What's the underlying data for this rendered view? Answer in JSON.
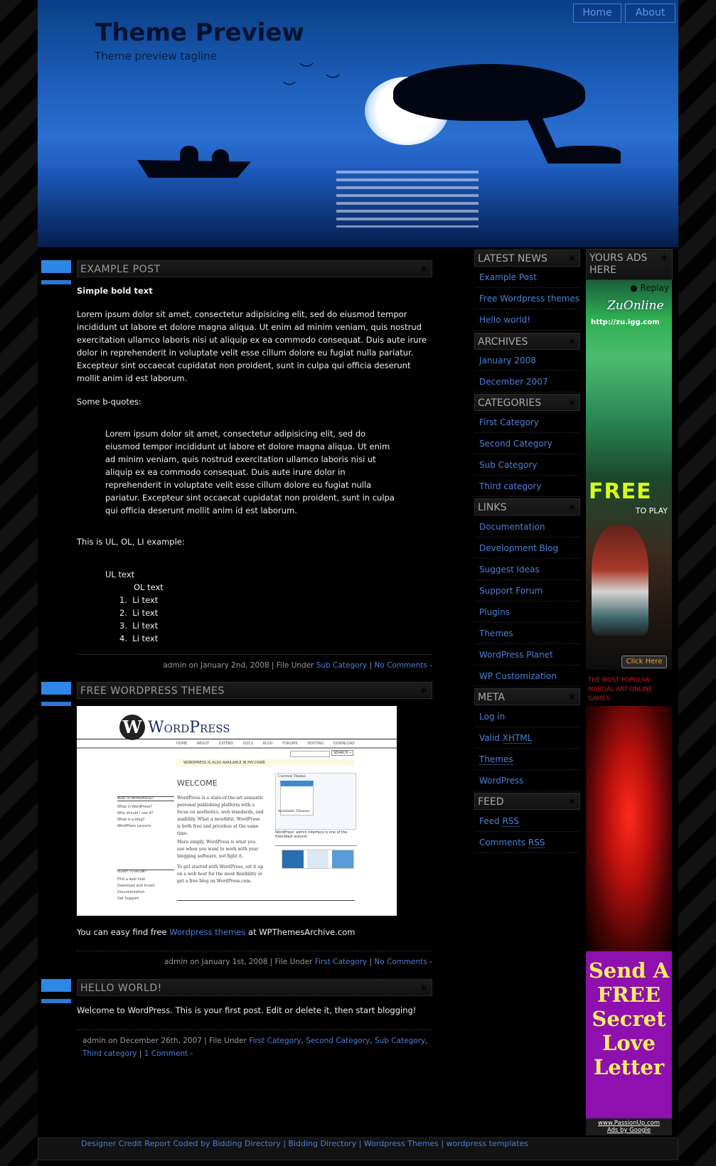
{
  "header": {
    "site_title": "Theme Preview",
    "tagline": "Theme preview tagline",
    "nav": [
      {
        "label": "Home"
      },
      {
        "label": "About"
      }
    ]
  },
  "posts": [
    {
      "title": "EXAMPLE POST",
      "bold_text": "Simple bold text",
      "paragraph": "Lorem ipsum dolor sit amet, consectetur adipisicing elit, sed do eiusmod tempor incididunt ut labore et dolore magna aliqua. Ut enim ad minim veniam, quis nostrud exercitation ullamco laboris nisi ut aliquip ex ea commodo consequat. Duis aute irure dolor in reprehenderit in voluptate velit esse cillum dolore eu fugiat nulla pariatur. Excepteur sint occaecat cupidatat non proident, sunt in culpa qui officia deserunt mollit anim id est laborum.",
      "bquote_intro": "Some b-quotes:",
      "blockquote": "Lorem ipsum dolor sit amet, consectetur adipisicing elit, sed do eiusmod tempor incididunt ut labore et dolore magna aliqua. Ut enim ad minim veniam, quis nostrud exercitation ullamco laboris nisi ut aliquip ex ea commodo consequat. Duis aute irure dolor in reprehenderit in voluptate velit esse cillum dolore eu fugiat nulla pariatur. Excepteur sint occaecat cupidatat non proident, sunt in culpa qui officia deserunt mollit anim id est laborum.",
      "list_intro": "This is UL, OL, LI example:",
      "ul_text": "UL text",
      "ol_text": "OL text",
      "li_items": [
        "Li text",
        "Li text",
        "Li text",
        "Li text"
      ],
      "meta": {
        "prefix": "admin on January 2nd, 2008 | File Under ",
        "categories": [
          "Sub Category"
        ],
        "sep": " | ",
        "comments": "No Comments",
        "suffix": " -"
      }
    },
    {
      "title": "FREE WORDPRESS THEMES",
      "screenshot": {
        "logo": "WordPress",
        "nav": [
          "HOME",
          "ABOUT",
          "EXTEND",
          "DOCS",
          "BLOG",
          "FORUMS",
          "HOSTING",
          "DOWNLOAD"
        ],
        "search_button": "SEARCH »",
        "notice": "WORDPRESS IS ALSO AVAILABLE IN РУССКИЙ.",
        "welcome": "WELCOME",
        "intro": "WordPress is a state-of-the-art semantic personal publishing platform with a focus on aesthetics, web standards, and usability. What a mouthful. WordPress is both free and priceless at the same time.",
        "intro2": "More simply, WordPress is what you use when you want to work with your blogging software, not fight it.",
        "intro3": "To get started with WordPress, set it up on a web host for the most flexibility or get a free blog on WordPress.com.",
        "new_heading": "NEW TO WORDPRESS?",
        "new_links": [
          "What is WordPress?",
          "Why should I use it?",
          "What is a blog?",
          "WordPress Lessons"
        ],
        "ready_heading": "READY TO BEGIN?",
        "ready_links": [
          "Find a web host",
          "Download and Install",
          "Documentation",
          "Get Support"
        ],
        "current_theme": "Current Theme",
        "available_themes": "Available Themes",
        "caption": "WordPress' admin interface is one of the friendliest around."
      },
      "text_before": "You can easy find free ",
      "text_link": "Wordpress themes",
      "text_after": " at WPThemesArchive.com",
      "meta": {
        "prefix": "admin on January 1st, 2008 | File Under ",
        "categories": [
          "First Category"
        ],
        "sep": " | ",
        "comments": "No Comments",
        "suffix": " -"
      }
    },
    {
      "title": "HELLO WORLD!",
      "text": "Welcome to WordPress. This is your first post. Edit or delete it, then start blogging!",
      "meta": {
        "prefix": "admin on December 26th, 2007 | File Under ",
        "categories": [
          "First Category",
          "Second Category",
          "Sub Category",
          "Third category"
        ],
        "sep": " | ",
        "comments": "1 Comment",
        "suffix": " -"
      }
    }
  ],
  "sidebar": {
    "latest_news": {
      "title": "LATEST NEWS",
      "items": [
        "Example Post",
        "Free Wordpress themes",
        "Hello world!"
      ]
    },
    "archives": {
      "title": "ARCHIVES",
      "items": [
        "January 2008",
        "December 2007"
      ]
    },
    "categories": {
      "title": "CATEGORIES",
      "items": [
        "First Category",
        "Second Category",
        "Sub Category",
        "Third category"
      ]
    },
    "links": {
      "title": "LINKS",
      "items": [
        "Documentation",
        "Development Blog",
        "Suggest Ideas",
        "Support Forum",
        "Plugins",
        "Themes",
        "WordPress Planet",
        "WP Customization"
      ]
    },
    "meta": {
      "title": "META",
      "items": [
        "Log in",
        "Valid ",
        "XHTML",
        "Themes",
        "WordPress"
      ]
    },
    "feed": {
      "title": "FEED",
      "items": [
        "Feed ",
        "RSS",
        "Comments ",
        "RSS"
      ]
    }
  },
  "ads": {
    "title": "YOURS ADS HERE",
    "ad1": {
      "replay": "Replay",
      "brand": "ZuOnline",
      "url": "http://zu.igg.com",
      "free": "FREE",
      "to_play": "TO PLAY",
      "cta": "Click Here",
      "tagline": "THE MOST POPULAR MARTIAL ART ONLINE GAMES"
    },
    "ad3": {
      "text": "Send A FREE Secret Love Letter"
    },
    "attribution": [
      "www.PassionUp.com",
      "Ads by Google"
    ]
  },
  "footer": {
    "links": [
      "Designer Credit Report Coded by Bidding Directory",
      "Bidding Directory",
      "Wordpress Themes",
      "wordpress templates"
    ],
    "sep": " | "
  }
}
